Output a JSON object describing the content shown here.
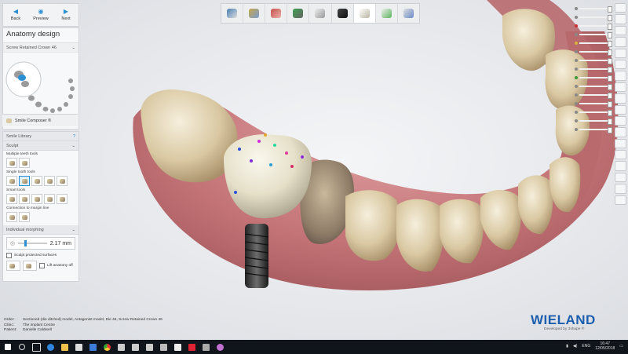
{
  "nav": {
    "back": "Back",
    "preview": "Preview",
    "next": "Next"
  },
  "panel": {
    "title": "Anatomy design",
    "selection": "Screw Retained Crown 46",
    "smile_composer": "Smile Composer ®"
  },
  "sculpt_panel": {
    "library": "Smile Library",
    "library_help": "?",
    "sculpt": "Sculpt",
    "multi_tools": "Multiple teeth tools",
    "single_tools": "Single tooth tools",
    "smart_tools": "Smart tools",
    "connection": "Connection to margin line",
    "morphing": "Individual morphing",
    "morph_value": "2.17 mm",
    "protected": "Sculpt protected surfaces",
    "lift_anatomy": "Lift anatomy off"
  },
  "info": {
    "order_label": "Order:",
    "order": "Sectioned (die ditched) model, Antagonist model, Die 46, Screw Retained Crown 46",
    "clinic_label": "Clinic:",
    "clinic": "The Implant Centre",
    "patient_label": "Patient:",
    "patient": "Danielle Caldwell"
  },
  "brand": {
    "logo": "WIELAND",
    "sub": "Developed by 3shape ®"
  },
  "taskbar": {
    "lang": "ENG",
    "time": "16:47",
    "date": "12/05/2018"
  },
  "colors": {
    "accent": "#2a8fd3",
    "brand": "#1d5fae",
    "gum": "#c97a7c",
    "crown": "#e9e4cf"
  }
}
